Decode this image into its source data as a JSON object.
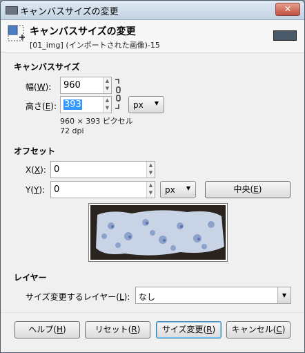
{
  "window": {
    "title": "キャンバスサイズの変更",
    "close_label": "✕"
  },
  "header": {
    "title": "キャンバスサイズの変更",
    "subtitle": "[01_img] (インポートされた画像)-15"
  },
  "canvas_size": {
    "section": "キャンバスサイズ",
    "width_label": "幅(",
    "width_key": "W",
    "width_suffix": "):",
    "width_value": "960",
    "height_label": "高さ(",
    "height_key": "E",
    "height_suffix": "):",
    "height_value": "393",
    "unit": "px",
    "info_size": "960 × 393 ピクセル",
    "info_dpi": "72 dpi"
  },
  "offset": {
    "section": "オフセット",
    "x_label": "X(",
    "x_key": "X",
    "x_suffix": "):",
    "x_value": "0",
    "y_label": "Y(",
    "y_key": "Y",
    "y_suffix": "):",
    "y_value": "0",
    "unit": "px",
    "center_label": "中央(",
    "center_key": "E",
    "center_suffix": ")"
  },
  "layers": {
    "section": "レイヤー",
    "resize_label": "サイズ変更するレイヤー(",
    "resize_key": "L",
    "resize_suffix": "):",
    "resize_value": "なし"
  },
  "buttons": {
    "help": "ヘルプ(",
    "help_key": "H",
    "reset": "リセット(",
    "reset_key": "R",
    "resize": "サイズ変更(",
    "resize_key": "R",
    "cancel": "キャンセル(",
    "cancel_key": "C",
    "close_paren": ")"
  },
  "colors": {
    "accent": "#3399ff",
    "titlebar": "#c3d3e3",
    "background": "#f0f0f0"
  }
}
